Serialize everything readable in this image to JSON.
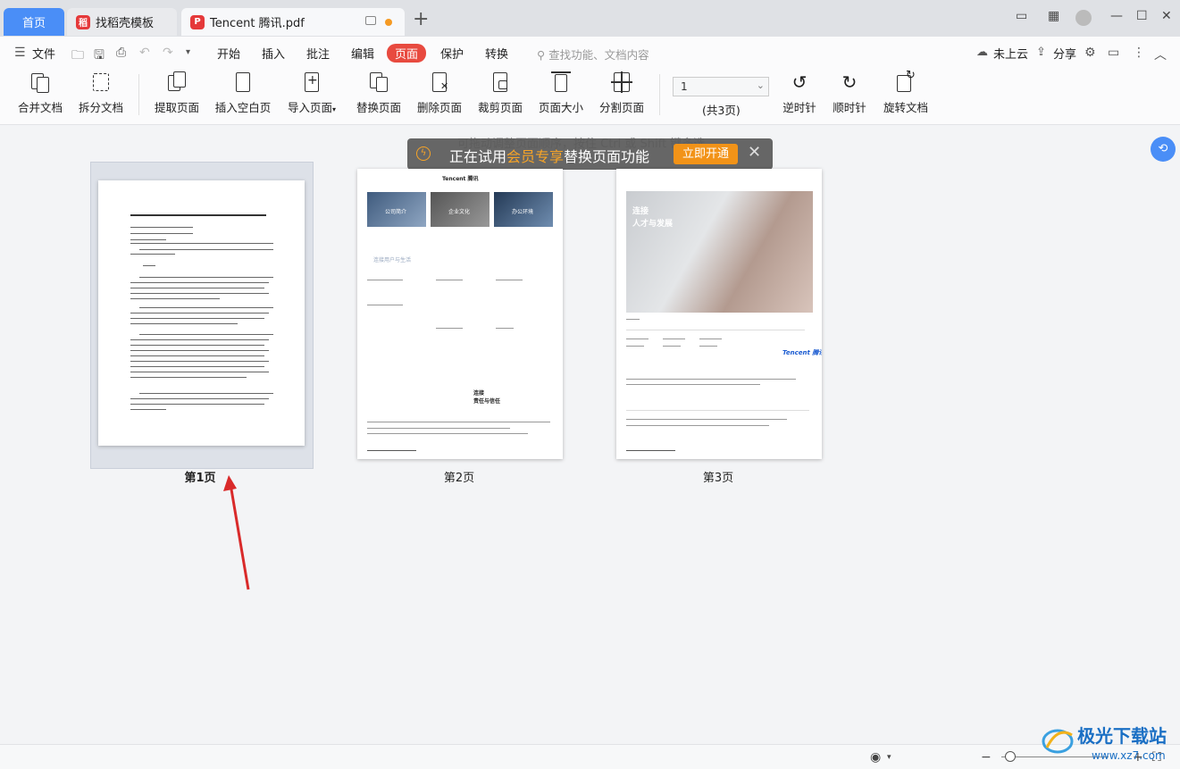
{
  "tabs": {
    "home": "首页",
    "template": "找稻壳模板",
    "document": "Tencent 腾讯.pdf"
  },
  "menu": {
    "file": "文件",
    "items": [
      "开始",
      "插入",
      "批注",
      "编辑",
      "页面",
      "保护",
      "转换"
    ],
    "active": "页面",
    "search_placeholder": "查找功能、文档内容",
    "cloud": "未上云",
    "share": "分享"
  },
  "ribbon": {
    "buttons": [
      "合并文档",
      "拆分文档",
      "提取页面",
      "插入空白页",
      "导入页面",
      "替换页面",
      "删除页面",
      "裁剪页面",
      "页面大小",
      "分割页面"
    ],
    "page_number": "1",
    "page_total": "(共3页)",
    "rotate": [
      "逆时针",
      "顺时针",
      "旋转文档"
    ]
  },
  "content": {
    "hint": "可拖动调整页面顺序，按住 Ctrl 或 Shift 键多选",
    "toast": {
      "prefix": "正在试用",
      "highlight": "会员专享",
      "suffix": "替换页面功能",
      "button": "立即开通"
    },
    "pages": [
      "第1页",
      "第2页",
      "第3页"
    ],
    "selected_page": 1
  },
  "page3": {
    "heading": "连接",
    "subheading": "人才与发展",
    "brand": "Tencent 腾讯"
  },
  "page2": {
    "header": "Tencent 腾讯",
    "tiles": [
      "公司简介",
      "企业文化",
      "办公环境"
    ],
    "section": "连接用户与生活",
    "footer_title": "连接",
    "footer_sub": "责任与信任"
  },
  "colors": {
    "accent_blue": "#4a8ef7",
    "active_tab_red": "#e84a3f",
    "toast_orange": "#f29318",
    "arrow_red": "#d92a2a"
  },
  "watermark": {
    "site": "极光下载站",
    "url": "www.xz7.com"
  }
}
